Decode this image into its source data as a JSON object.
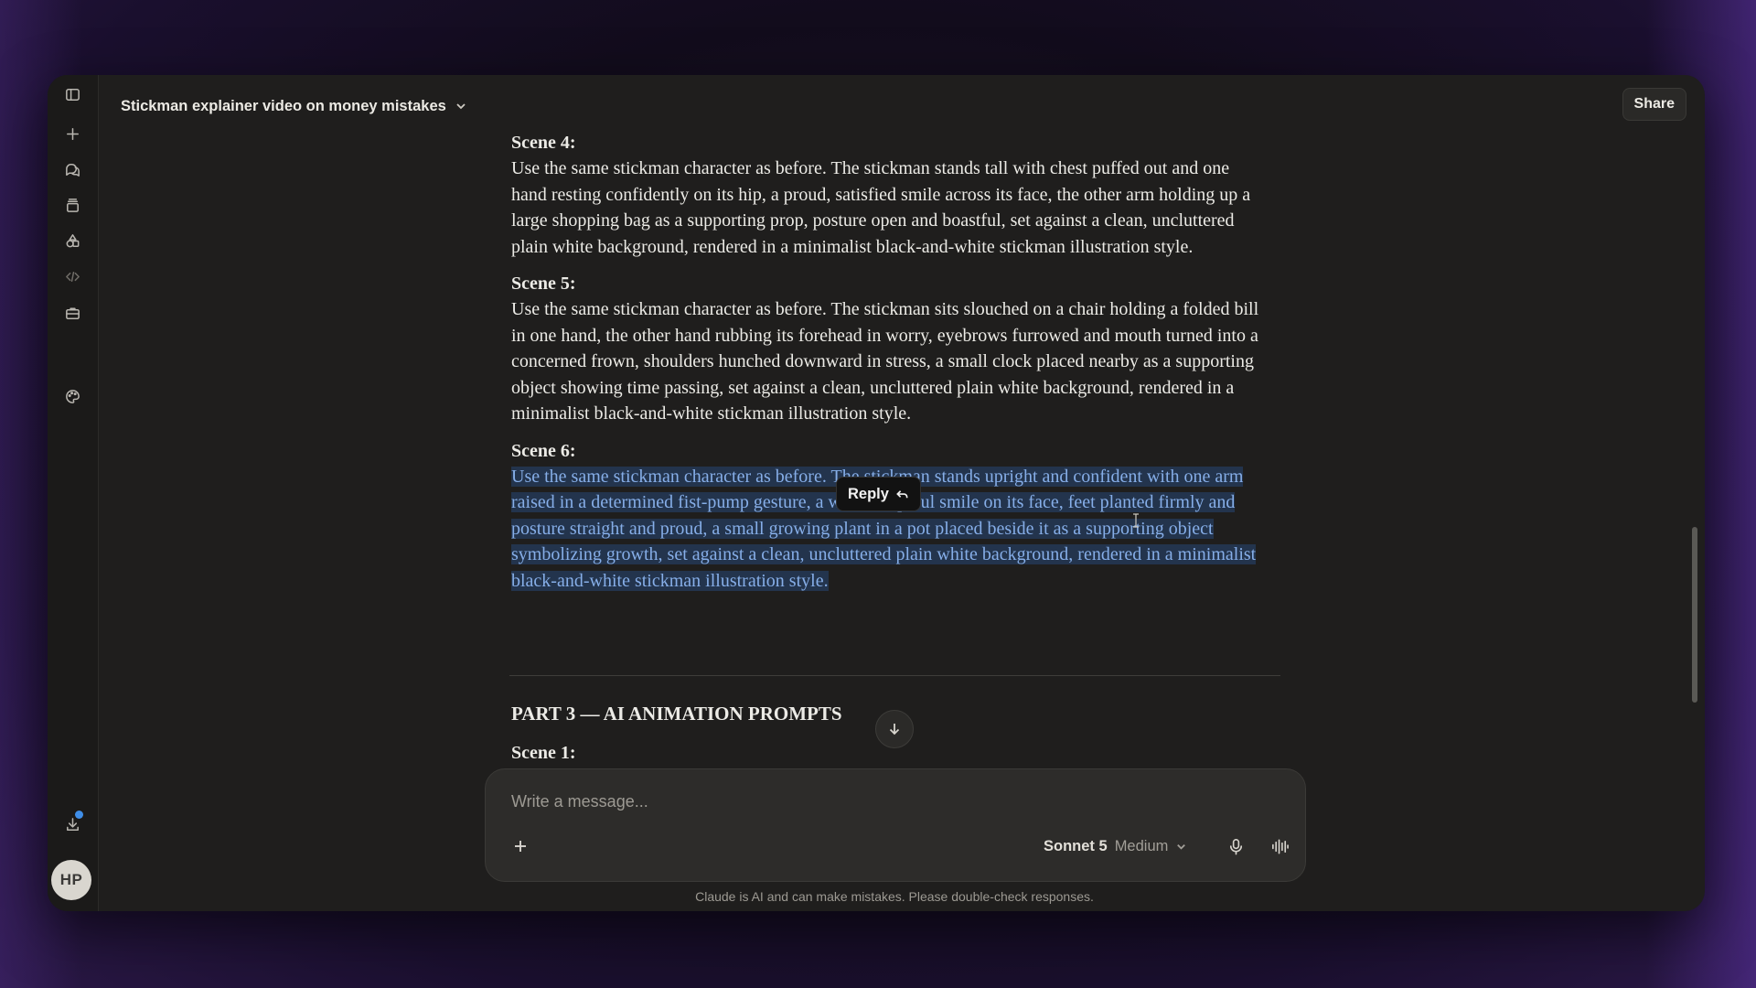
{
  "header": {
    "title": "Stickman explainer video on money mistakes",
    "share_label": "Share"
  },
  "sidebar": {
    "items": [
      {
        "icon": "sidebar-toggle-icon"
      },
      {
        "icon": "plus-icon"
      },
      {
        "icon": "chats-icon"
      },
      {
        "icon": "projects-icon"
      },
      {
        "icon": "artifacts-icon"
      },
      {
        "icon": "code-icon"
      },
      {
        "icon": "briefcase-icon"
      },
      {
        "icon": "palette-icon"
      },
      {
        "icon": "download-icon"
      }
    ],
    "avatar_initials": "HP"
  },
  "message": {
    "scenes": [
      {
        "heading": "Scene 4:",
        "text": "Use the same stickman character as before. The stickman stands tall with chest puffed out and one hand resting confidently on its hip, a proud, satisfied smile across its face, the other arm holding up a large shopping bag as a supporting prop, posture open and boastful, set against a clean, uncluttered plain white background, rendered in a minimalist black-and-white stickman illustration style."
      },
      {
        "heading": "Scene 5:",
        "text": "Use the same stickman character as before. The stickman sits slouched on a chair holding a folded bill in one hand, the other hand rubbing its forehead in worry, eyebrows furrowed and mouth turned into a concerned frown, shoulders hunched downward in stress, a small clock placed nearby as a supporting object showing time passing, set against a clean, uncluttered plain white background, rendered in a minimalist black-and-white stickman illustration style."
      },
      {
        "heading": "Scene 6:",
        "text": "Use the same stickman character as before. The stickman stands upright and confident with one arm raised in a determined fist-pump gesture, a warm, hopeful smile on its face, feet planted firmly and posture straight and proud, a small growing plant in a pot placed beside it as a supporting object symbolizing growth, set against a clean, uncluttered plain white background, rendered in a minimalist black-and-white stickman illustration style."
      }
    ],
    "part_heading": "PART 3 — AI ANIMATION PROMPTS",
    "next_scene_heading": "Scene 1:",
    "reply_label": "Reply"
  },
  "composer": {
    "placeholder": "Write a message...",
    "model_name": "Sonnet 5",
    "effort": "Medium"
  },
  "footer": {
    "disclaimer": "Claude is AI and can make mistakes. Please double-check responses."
  }
}
